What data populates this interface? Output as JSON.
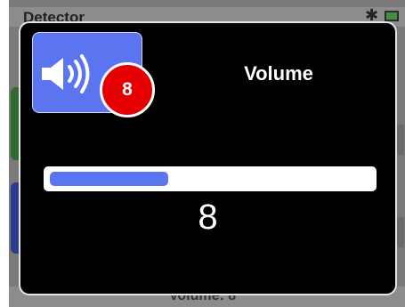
{
  "background": {
    "app_title": "Detector",
    "status_text": "Volume: 8",
    "gear_icon": "gear-icon",
    "battery_icon": "battery-icon"
  },
  "dialog": {
    "icon": "speaker-volume-icon",
    "badge_value": "8",
    "title": "Volume",
    "value": "8",
    "progress_fraction": 0.37,
    "accent_color": "#5b74ef",
    "badge_color": "#e40000"
  }
}
